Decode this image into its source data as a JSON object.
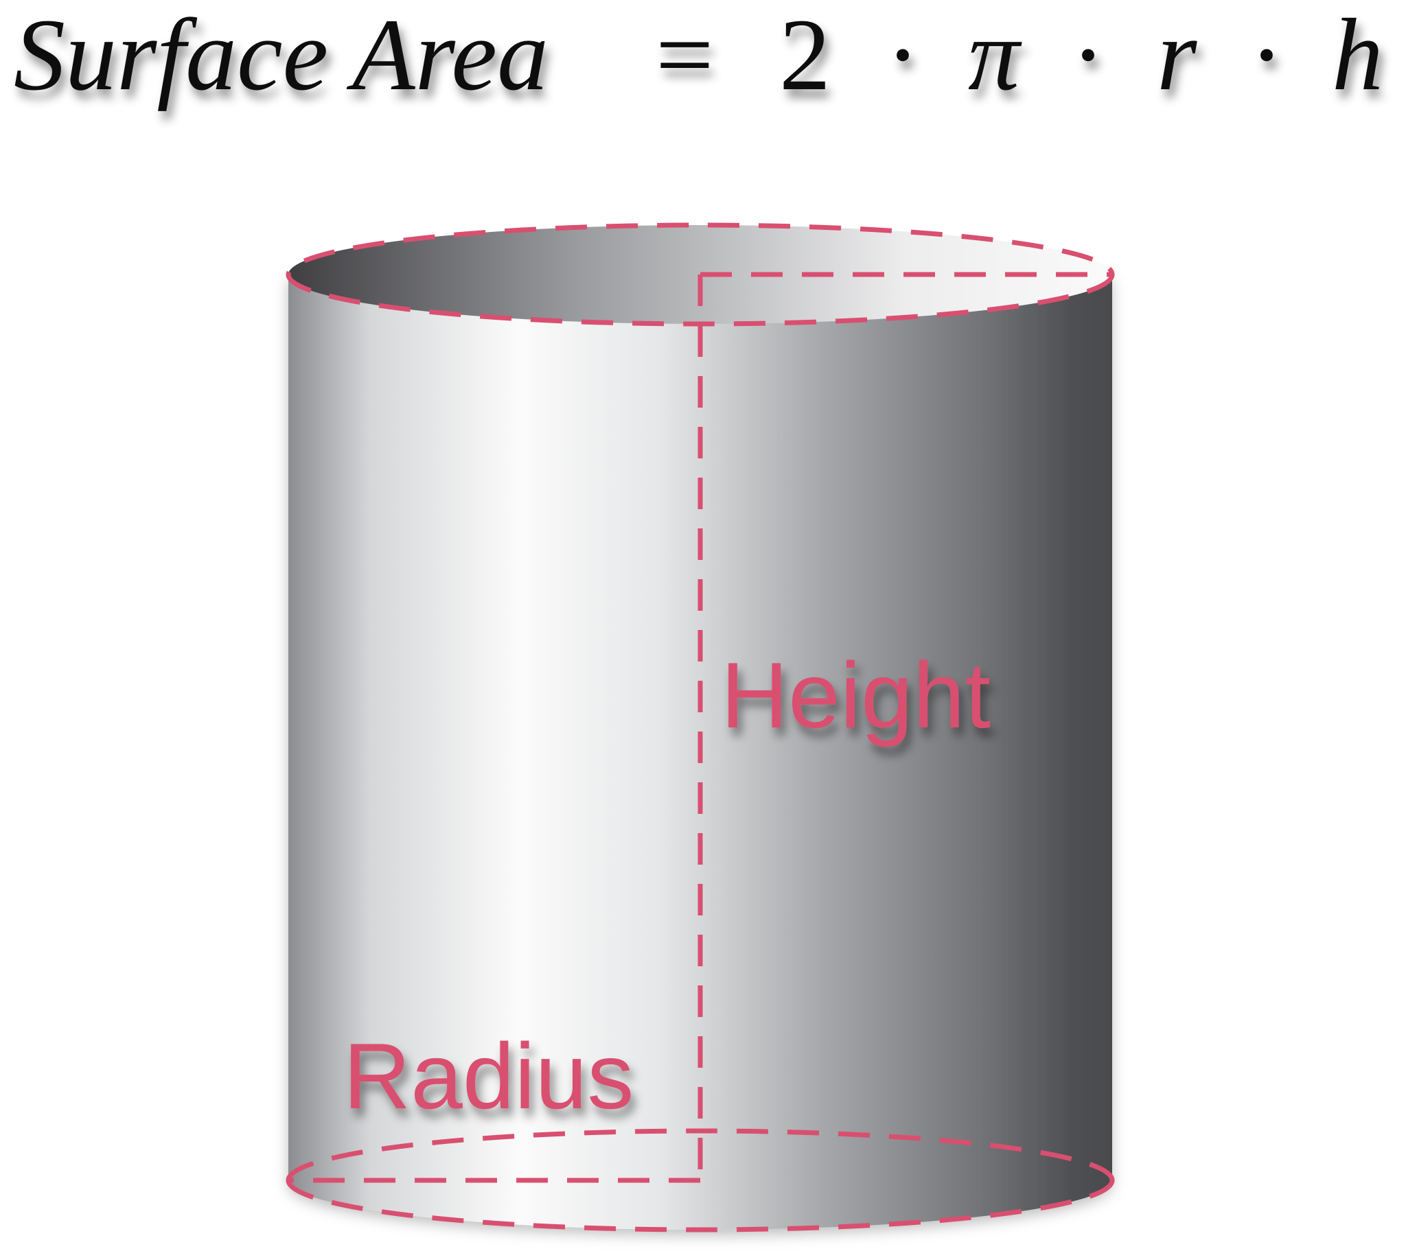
{
  "formula": {
    "lhs": "Surface Area",
    "equals": "=",
    "terms": [
      "2",
      "π",
      "r",
      "h"
    ],
    "operator": "·"
  },
  "labels": {
    "height": "Height",
    "radius": "Radius"
  },
  "colors": {
    "accent": "#D94F70",
    "cylinder_light": "#FAFAFA",
    "cylinder_dark": "#4A4A4D",
    "formula_text": "#111111"
  }
}
